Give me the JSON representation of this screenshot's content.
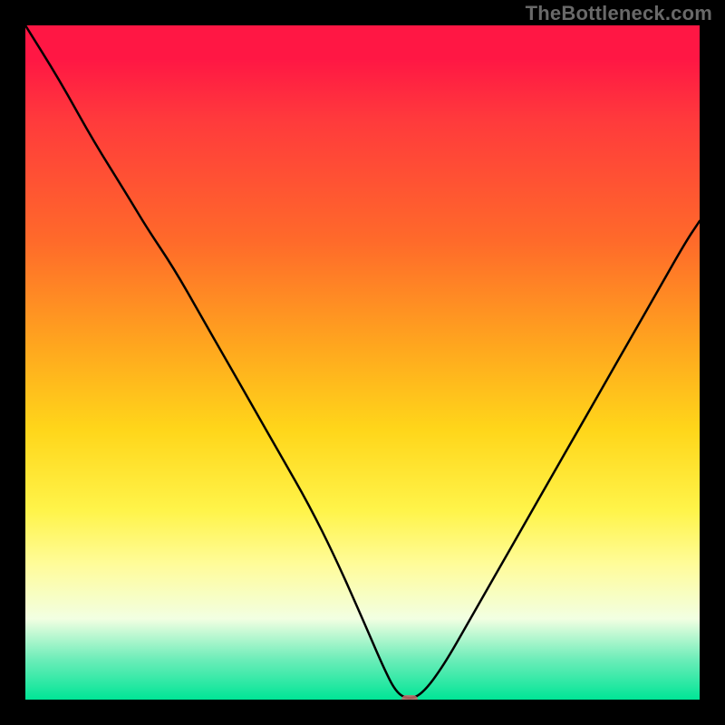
{
  "watermark": "TheBottleneck.com",
  "chart_data": {
    "type": "line",
    "title": "",
    "xlabel": "",
    "ylabel": "",
    "xlim": [
      0,
      100
    ],
    "ylim": [
      0,
      100
    ],
    "grid": false,
    "legend": false,
    "marker": {
      "x": 57,
      "color": "#c06a6a"
    },
    "background_gradient": {
      "direction": "vertical",
      "stops": [
        {
          "pct": 0,
          "color": "#ff1744"
        },
        {
          "pct": 5,
          "color": "#ff1744"
        },
        {
          "pct": 14,
          "color": "#ff3a3c"
        },
        {
          "pct": 32,
          "color": "#ff6a2a"
        },
        {
          "pct": 48,
          "color": "#ffa81e"
        },
        {
          "pct": 60,
          "color": "#ffd61a"
        },
        {
          "pct": 72,
          "color": "#fff44a"
        },
        {
          "pct": 80,
          "color": "#fffc9a"
        },
        {
          "pct": 88,
          "color": "#f2ffe2"
        },
        {
          "pct": 94,
          "color": "#6dedb9"
        },
        {
          "pct": 100,
          "color": "#00e596"
        }
      ]
    },
    "series": [
      {
        "name": "bottleneck-curve",
        "x": [
          0,
          5,
          10,
          15,
          18,
          22,
          26,
          30,
          34,
          38,
          42,
          46,
          50,
          53,
          55,
          57,
          59,
          62,
          66,
          70,
          74,
          78,
          82,
          86,
          90,
          94,
          98,
          100
        ],
        "values": [
          100,
          92,
          83,
          75,
          70,
          64,
          57,
          50,
          43,
          36,
          29,
          21,
          12,
          5,
          1,
          0,
          1,
          5,
          12,
          19,
          26,
          33,
          40,
          47,
          54,
          61,
          68,
          71
        ]
      }
    ]
  }
}
